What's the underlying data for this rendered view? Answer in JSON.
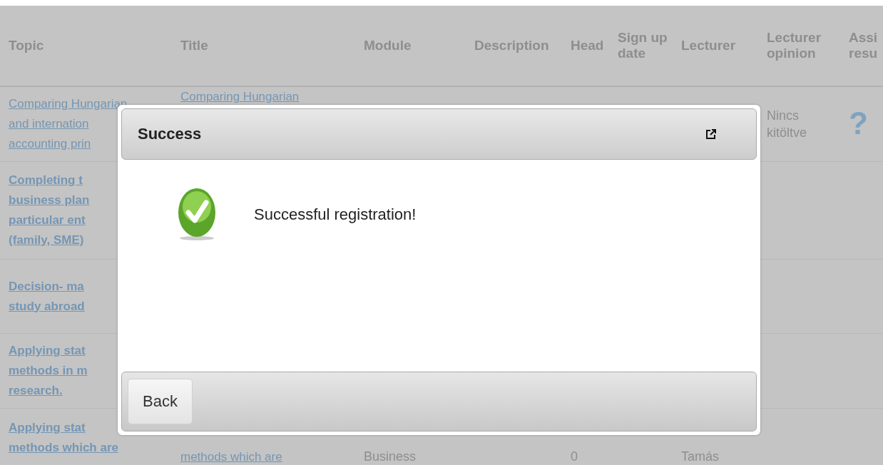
{
  "table": {
    "columns": [
      "Topic",
      "Title",
      "Module",
      "Description",
      "Head",
      "Sign up date",
      "Lecturer",
      "Lecturer opinion",
      "Assi resu"
    ],
    "rows": [
      {
        "topic": [
          "Comparing Hungarian",
          "and internation",
          "accounting prin"
        ],
        "emphasized": false,
        "title": [
          "Comparing Hungarian"
        ],
        "opinion": "Nincs kitöltve",
        "result": "?"
      },
      {
        "topic": [
          "Completing t",
          "business plan",
          "particular ent",
          "(family, SME)"
        ],
        "emphasized": true
      },
      {
        "topic": [
          "Decision- ma",
          "study abroad"
        ],
        "emphasized": true
      },
      {
        "topic": [
          "Applying stat",
          "methods in m",
          "research."
        ],
        "emphasized": true
      },
      {
        "topic": [
          "Applying stat",
          "methods which are"
        ],
        "emphasized": true,
        "title": [
          "methods which are"
        ],
        "module": "Business",
        "head": "0",
        "lecturer": "Tamás"
      }
    ]
  },
  "dialog": {
    "title": "Success",
    "message": "Successful registration!",
    "buttons": [
      "Back"
    ]
  }
}
